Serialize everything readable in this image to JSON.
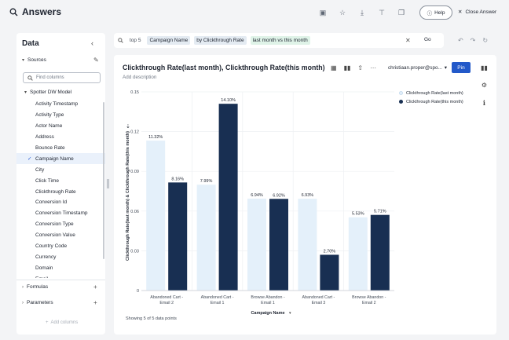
{
  "app": {
    "title": "Answers"
  },
  "topbar": {
    "help_label": "Help",
    "close_label": "Close Answer"
  },
  "sidebar": {
    "title": "Data",
    "sources_label": "Sources",
    "find_placeholder": "Find columns",
    "model_name": "Spotter DW Model",
    "columns": [
      "Activity Timestamp",
      "Activity Type",
      "Actor Name",
      "Address",
      "Bounce Rate",
      "Campaign Name",
      "City",
      "Click Time",
      "Clickthrough Rate",
      "Conversion Id",
      "Conversion Timestamp",
      "Conversion Type",
      "Conversion Value",
      "Country Code",
      "Currency",
      "Domain",
      "Email"
    ],
    "selected_column": "Campaign Name",
    "formulas_label": "Formulas",
    "parameters_label": "Parameters",
    "add_columns_label": "Add columns"
  },
  "search": {
    "tokens": [
      {
        "text": "top 5",
        "kind": "kw"
      },
      {
        "text": "Campaign Name",
        "kind": "col"
      },
      {
        "text": "by Clickthrough Rate",
        "kind": "col"
      },
      {
        "text": "last month vs this month",
        "kind": "filter"
      }
    ],
    "go_label": "Go"
  },
  "answer": {
    "title": "Clickthrough Rate(last month), Clickthrough Rate(this month) by C...",
    "add_description": "Add description",
    "owner": "christiaan.proper@spo...",
    "pin_label": "Pin",
    "showing_label": "Showing 5 of 5 data points"
  },
  "colors": {
    "last_month": "#e4f0fa",
    "this_month": "#182f52",
    "accent": "#2359c9"
  },
  "chart_data": {
    "type": "bar",
    "categories": [
      "Abandoned Cart - Email 2",
      "Abandoned Cart - Email 1",
      "Browse Abandon - Email 1",
      "Abandoned Cart - Email 3",
      "Browse Abandon - Email 2"
    ],
    "category_lines": [
      [
        "Abandoned Cart -",
        "Email 2"
      ],
      [
        "Abandoned Cart -",
        "Email 1"
      ],
      [
        "Browse Abandon -",
        "Email 1"
      ],
      [
        "Abandoned Cart -",
        "Email 3"
      ],
      [
        "Browse Abandon -",
        "Email 2"
      ]
    ],
    "series": [
      {
        "name": "Clickthrough Rate(last month)",
        "values": [
          0.1132,
          0.0799,
          0.0694,
          0.0693,
          0.0553
        ],
        "labels": [
          "11.32%",
          "7.99%",
          "6.94%",
          "6.93%",
          "5.53%"
        ]
      },
      {
        "name": "Clickthrough Rate(this month)",
        "values": [
          0.0816,
          0.141,
          0.0692,
          0.027,
          0.0571
        ],
        "labels": [
          "8.16%",
          "14.10%",
          "6.92%",
          "2.70%",
          "5.71%"
        ]
      }
    ],
    "xlabel": "Campaign Name",
    "ylabel": "Clickthrough Rate(last month) & Clickthrough Rate(this month)",
    "ylim": [
      0,
      0.15
    ],
    "yticks": [
      0,
      0.03,
      0.06,
      0.09,
      0.12,
      0.15
    ],
    "ytick_labels": [
      "0",
      "0.03",
      "0.06",
      "0.09",
      "0.12",
      "0.15"
    ],
    "legend_position": "top-right",
    "grid": true
  }
}
